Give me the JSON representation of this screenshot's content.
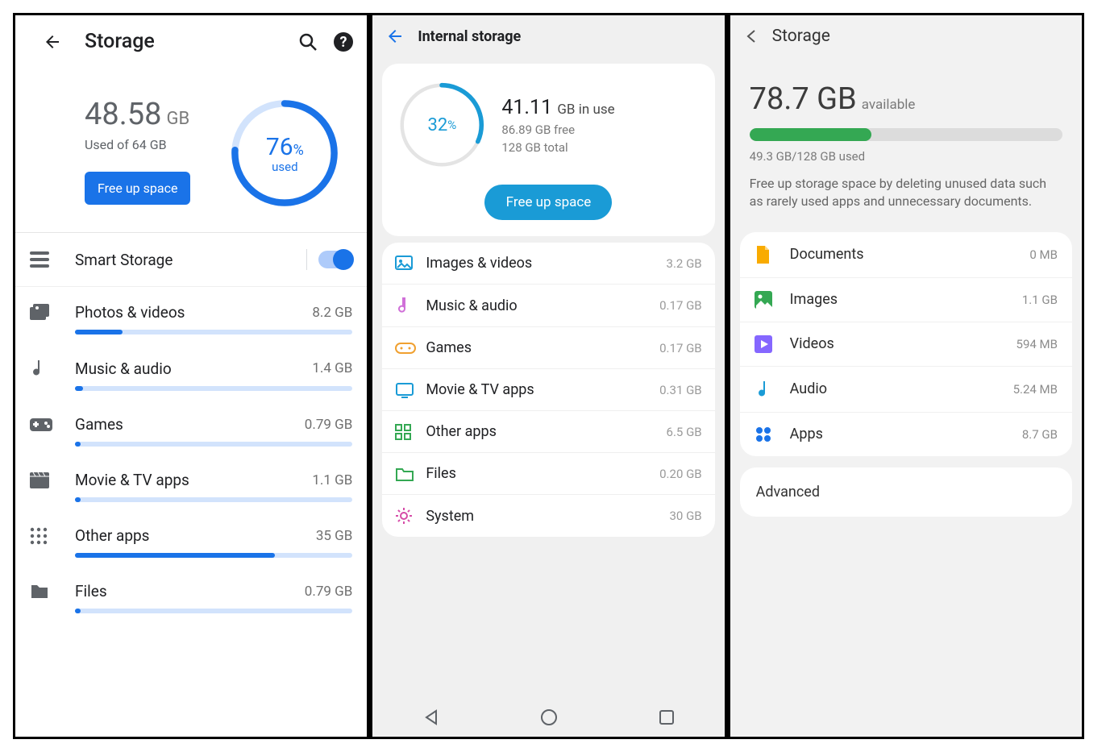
{
  "pane1": {
    "title": "Storage",
    "used_value": "48.58",
    "used_unit": "GB",
    "used_line2": "Used of 64 GB",
    "free_btn": "Free up space",
    "ring_pct": "76",
    "ring_pct_sym": "%",
    "ring_label": "used",
    "smart_label": "Smart Storage",
    "categories": [
      {
        "icon": "photo",
        "label": "Photos & videos",
        "size": "8.2 GB",
        "pct": 17
      },
      {
        "icon": "music",
        "label": "Music & audio",
        "size": "1.4 GB",
        "pct": 3
      },
      {
        "icon": "games",
        "label": "Games",
        "size": "0.79 GB",
        "pct": 2
      },
      {
        "icon": "movie",
        "label": "Movie & TV apps",
        "size": "1.1 GB",
        "pct": 2
      },
      {
        "icon": "apps",
        "label": "Other apps",
        "size": "35 GB",
        "pct": 72
      },
      {
        "icon": "files",
        "label": "Files",
        "size": "0.79 GB",
        "pct": 2
      }
    ]
  },
  "pane2": {
    "title": "Internal storage",
    "ring_pct": "32",
    "ring_pct_sym": "%",
    "used_value": "41.11",
    "used_suffix": "GB in use",
    "free_line": "86.89 GB free",
    "total_line": "128 GB total",
    "free_btn": "Free up space",
    "items": [
      {
        "icon": "images",
        "label": "Images & videos",
        "size": "3.2 GB",
        "color": "#1a9bd6"
      },
      {
        "icon": "music",
        "label": "Music & audio",
        "size": "0.17 GB",
        "color": "#d070d8"
      },
      {
        "icon": "games",
        "label": "Games",
        "size": "0.17 GB",
        "color": "#f0a030"
      },
      {
        "icon": "tv",
        "label": "Movie & TV apps",
        "size": "0.31 GB",
        "color": "#1a9bd6"
      },
      {
        "icon": "other",
        "label": "Other apps",
        "size": "6.5 GB",
        "color": "#34a853"
      },
      {
        "icon": "folder",
        "label": "Files",
        "size": "0.20 GB",
        "color": "#34a853"
      },
      {
        "icon": "gear",
        "label": "System",
        "size": "30 GB",
        "color": "#d64ca8"
      }
    ]
  },
  "pane3": {
    "title": "Storage",
    "avail_value": "78.7 GB",
    "avail_label": "available",
    "bar_pct": 39,
    "usage_line": "49.3 GB/128 GB used",
    "desc": "Free up storage space by deleting unused data such as rarely used apps and unnecessary documents.",
    "items": [
      {
        "icon": "doc",
        "label": "Documents",
        "size": "0 MB",
        "color": "#f9ab00"
      },
      {
        "icon": "img",
        "label": "Images",
        "size": "1.1 GB",
        "color": "#34a853"
      },
      {
        "icon": "vid",
        "label": "Videos",
        "size": "594 MB",
        "color": "#8567ff"
      },
      {
        "icon": "aud",
        "label": "Audio",
        "size": "5.24 MB",
        "color": "#1a9bd6"
      },
      {
        "icon": "apps",
        "label": "Apps",
        "size": "8.7 GB",
        "color": "#1a73e8"
      }
    ],
    "advanced": "Advanced"
  }
}
